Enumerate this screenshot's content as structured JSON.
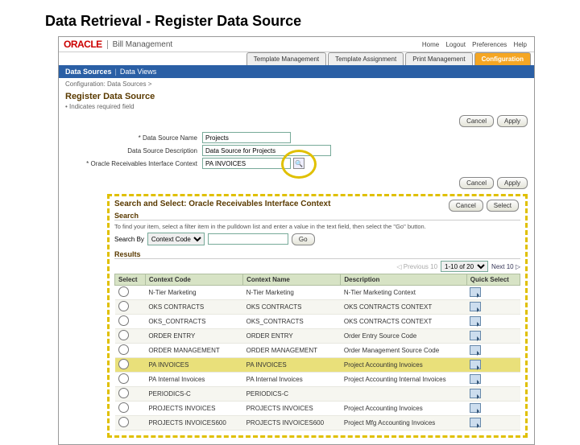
{
  "slide_title": "Data Retrieval - Register Data Source",
  "brand": {
    "logo": "ORACLE",
    "app": "Bill Management"
  },
  "top_links": [
    "Home",
    "Logout",
    "Preferences",
    "Help"
  ],
  "tabs": {
    "items": [
      "Template Management",
      "Template Assignment",
      "Print Management",
      "Configuration"
    ],
    "active": 3
  },
  "subtabs": {
    "items": [
      "Data Sources",
      "Data Views"
    ],
    "active": 0
  },
  "breadcrumb": "Configuration: Data Sources >",
  "page_title": "Register Data Source",
  "required_note": "Indicates required field",
  "buttons": {
    "cancel": "Cancel",
    "apply": "Apply",
    "select": "Select",
    "go": "Go"
  },
  "form": {
    "ds_name_label": "* Data Source Name",
    "ds_name_value": "Projects",
    "ds_desc_label": "Data Source Description",
    "ds_desc_value": "Data Source for Projects",
    "ctx_label": "* Oracle Receivables Interface Context",
    "ctx_value": "PA INVOICES"
  },
  "dialog": {
    "title": "Search and Select: Oracle Receivables Interface Context",
    "search_section": "Search",
    "hint": "To find your item, select a filter item in the pulldown list and enter a value in the text field, then select the \"Go\" button.",
    "search_by_label": "Search By",
    "search_by_value": "Context Code",
    "search_text": "",
    "results_section": "Results",
    "pager": {
      "prev": "Previous 10",
      "range": "1-10 of 20",
      "next": "Next 10"
    },
    "columns": [
      "Select",
      "Context Code",
      "Context Name",
      "Description",
      "Quick Select"
    ],
    "rows": [
      {
        "code": "N-Tier Marketing",
        "name": "N-Tier Marketing",
        "desc": "N-Tier Marketing Context"
      },
      {
        "code": "OKS CONTRACTS",
        "name": "OKS CONTRACTS",
        "desc": "OKS CONTRACTS CONTEXT"
      },
      {
        "code": "OKS_CONTRACTS",
        "name": "OKS_CONTRACTS",
        "desc": "OKS CONTRACTS CONTEXT"
      },
      {
        "code": "ORDER ENTRY",
        "name": "ORDER ENTRY",
        "desc": "Order Entry Source Code"
      },
      {
        "code": "ORDER MANAGEMENT",
        "name": "ORDER MANAGEMENT",
        "desc": "Order Management Source Code"
      },
      {
        "code": "PA INVOICES",
        "name": "PA INVOICES",
        "desc": "Project Accounting Invoices"
      },
      {
        "code": "PA Internal Invoices",
        "name": "PA Internal Invoices",
        "desc": "Project Accounting Internal Invoices"
      },
      {
        "code": "PERIODICS-C",
        "name": "PERIODICS-C",
        "desc": ""
      },
      {
        "code": "PROJECTS INVOICES",
        "name": "PROJECTS INVOICES",
        "desc": "Project Accounting Invoices"
      },
      {
        "code": "PROJECTS INVOICES600",
        "name": "PROJECTS INVOICES600",
        "desc": "Project Mfg Accounting Invoices"
      }
    ],
    "highlight_index": 5
  }
}
